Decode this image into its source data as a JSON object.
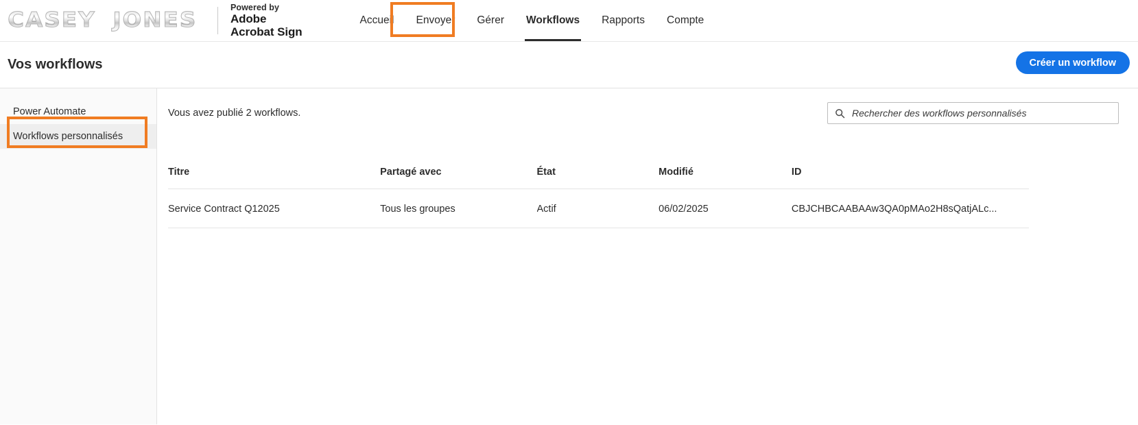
{
  "brand": {
    "logo_word_1": "CASEY",
    "logo_word_2": "JONES",
    "powered_by": "Powered by",
    "product_line_1": "Adobe",
    "product_line_2": "Acrobat Sign"
  },
  "nav": {
    "items": [
      {
        "label": "Accueil",
        "active": false
      },
      {
        "label": "Envoyer",
        "active": false
      },
      {
        "label": "Gérer",
        "active": false
      },
      {
        "label": "Workflows",
        "active": true
      },
      {
        "label": "Rapports",
        "active": false
      },
      {
        "label": "Compte",
        "active": false
      }
    ]
  },
  "header": {
    "title": "Vos workflows",
    "create_button": "Créer un workflow"
  },
  "sidebar": {
    "items": [
      {
        "label": "Power Automate",
        "selected": false
      },
      {
        "label": "Workflows personnalisés",
        "selected": true
      }
    ]
  },
  "main": {
    "published_text": "Vous avez publié 2 workflows.",
    "search": {
      "placeholder": "Rechercher des workflows personnalisés",
      "value": "",
      "icon": "search-icon"
    },
    "table": {
      "columns": [
        "Titre",
        "Partagé avec",
        "État",
        "Modifié",
        "ID"
      ],
      "rows": [
        {
          "title": "Service Contract Q12025",
          "shared_with": "Tous les groupes",
          "state": "Actif",
          "modified": "06/02/2025",
          "id": "CBJCHBCAABAAw3QA0pMAo2H8sQatjALc..."
        }
      ]
    }
  },
  "colors": {
    "accent_blue": "#1473e6",
    "annotation_orange": "#f07c22",
    "sidebar_bg": "#fafafa",
    "text": "#2c2c2c"
  }
}
